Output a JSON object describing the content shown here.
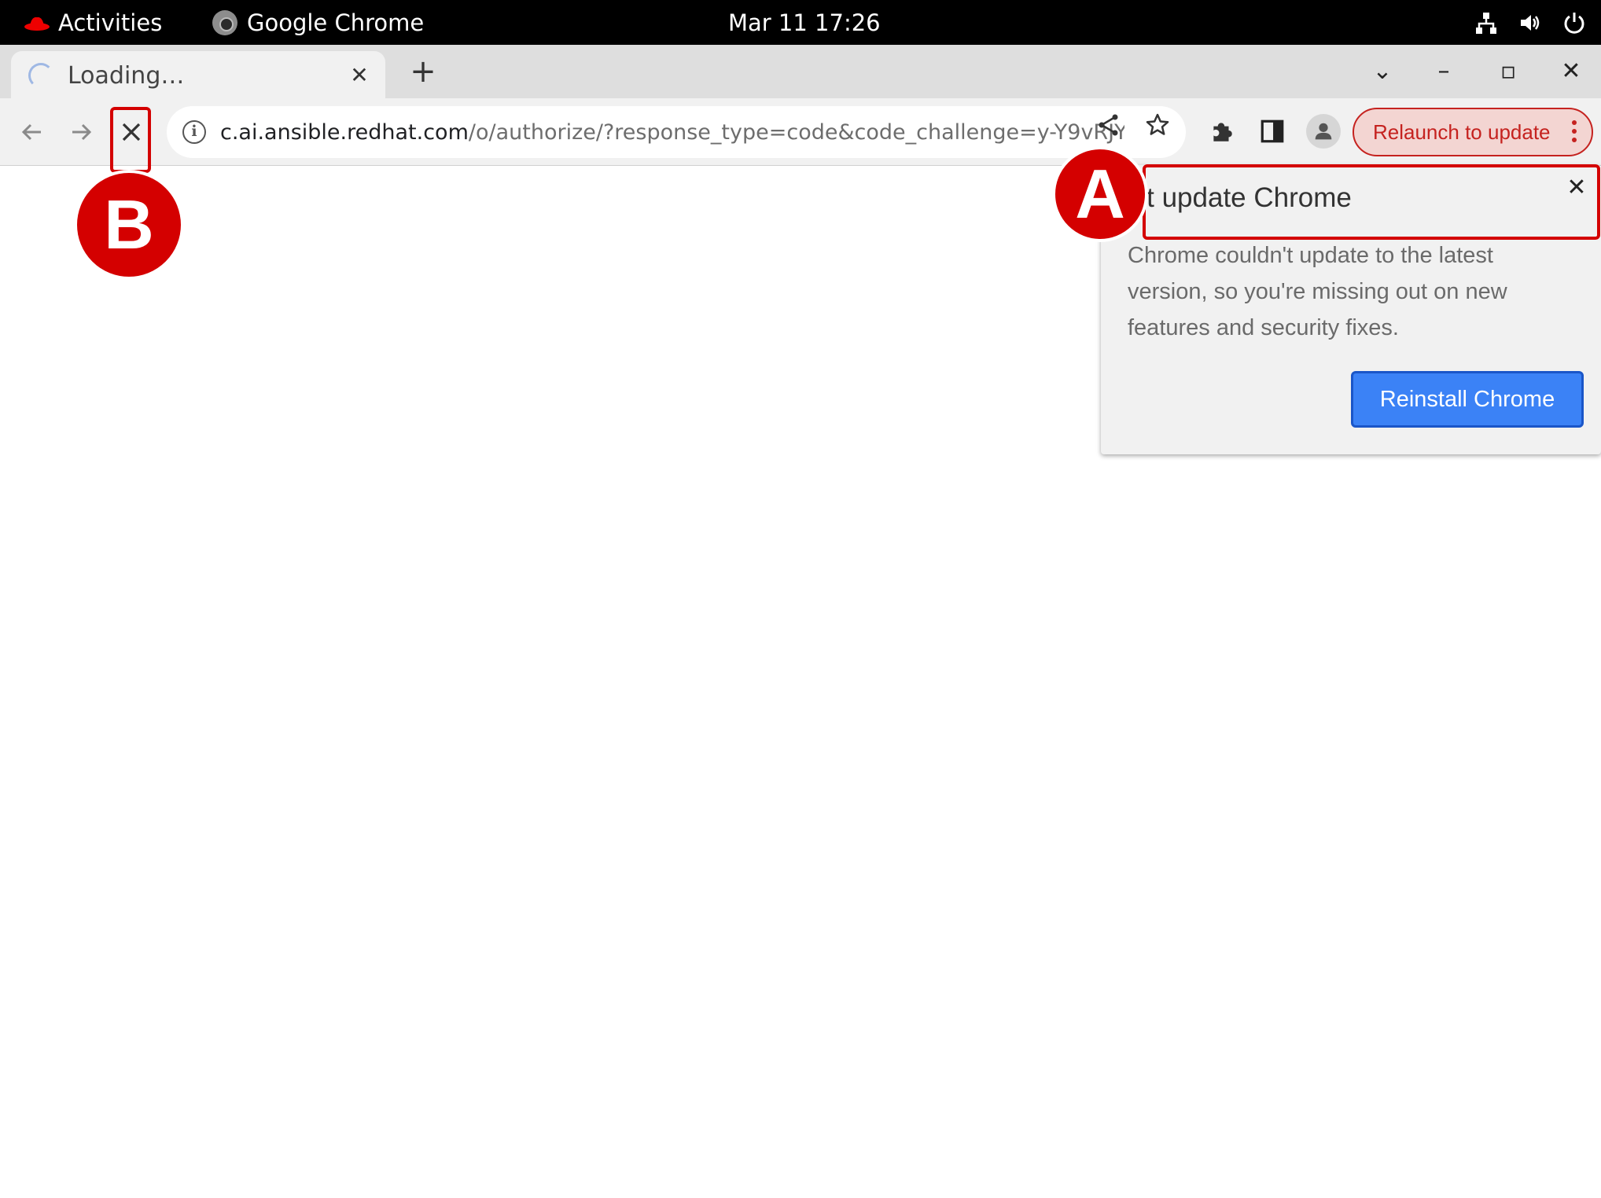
{
  "topbar": {
    "activities": "Activities",
    "app_name": "Google Chrome",
    "clock": "Mar 11  17:26"
  },
  "tab": {
    "title": "Loading…",
    "close": "✕"
  },
  "newtab_glyph": "+",
  "window_controls": {
    "dropdown": "⌄",
    "minimize": "–",
    "maximize": "▫",
    "close": "✕"
  },
  "omnibox": {
    "host": "c.ai.ansible.redhat.com",
    "path": "/o/authorize/?response_type=code&code_challenge=y-Y9vRJY..."
  },
  "toolbar": {
    "relaunch_label": "Relaunch to update"
  },
  "bubble": {
    "title": "n't update Chrome",
    "close": "✕",
    "body": "Chrome couldn't update to the latest version, so you're missing out on new features and security fixes.",
    "button": "Reinstall Chrome"
  },
  "annotations": {
    "a_label": "A",
    "b_label": "B",
    "color": "#d40000"
  },
  "colors": {
    "accent_blue": "#3b82f6",
    "relaunch_red": "#c5221f"
  }
}
